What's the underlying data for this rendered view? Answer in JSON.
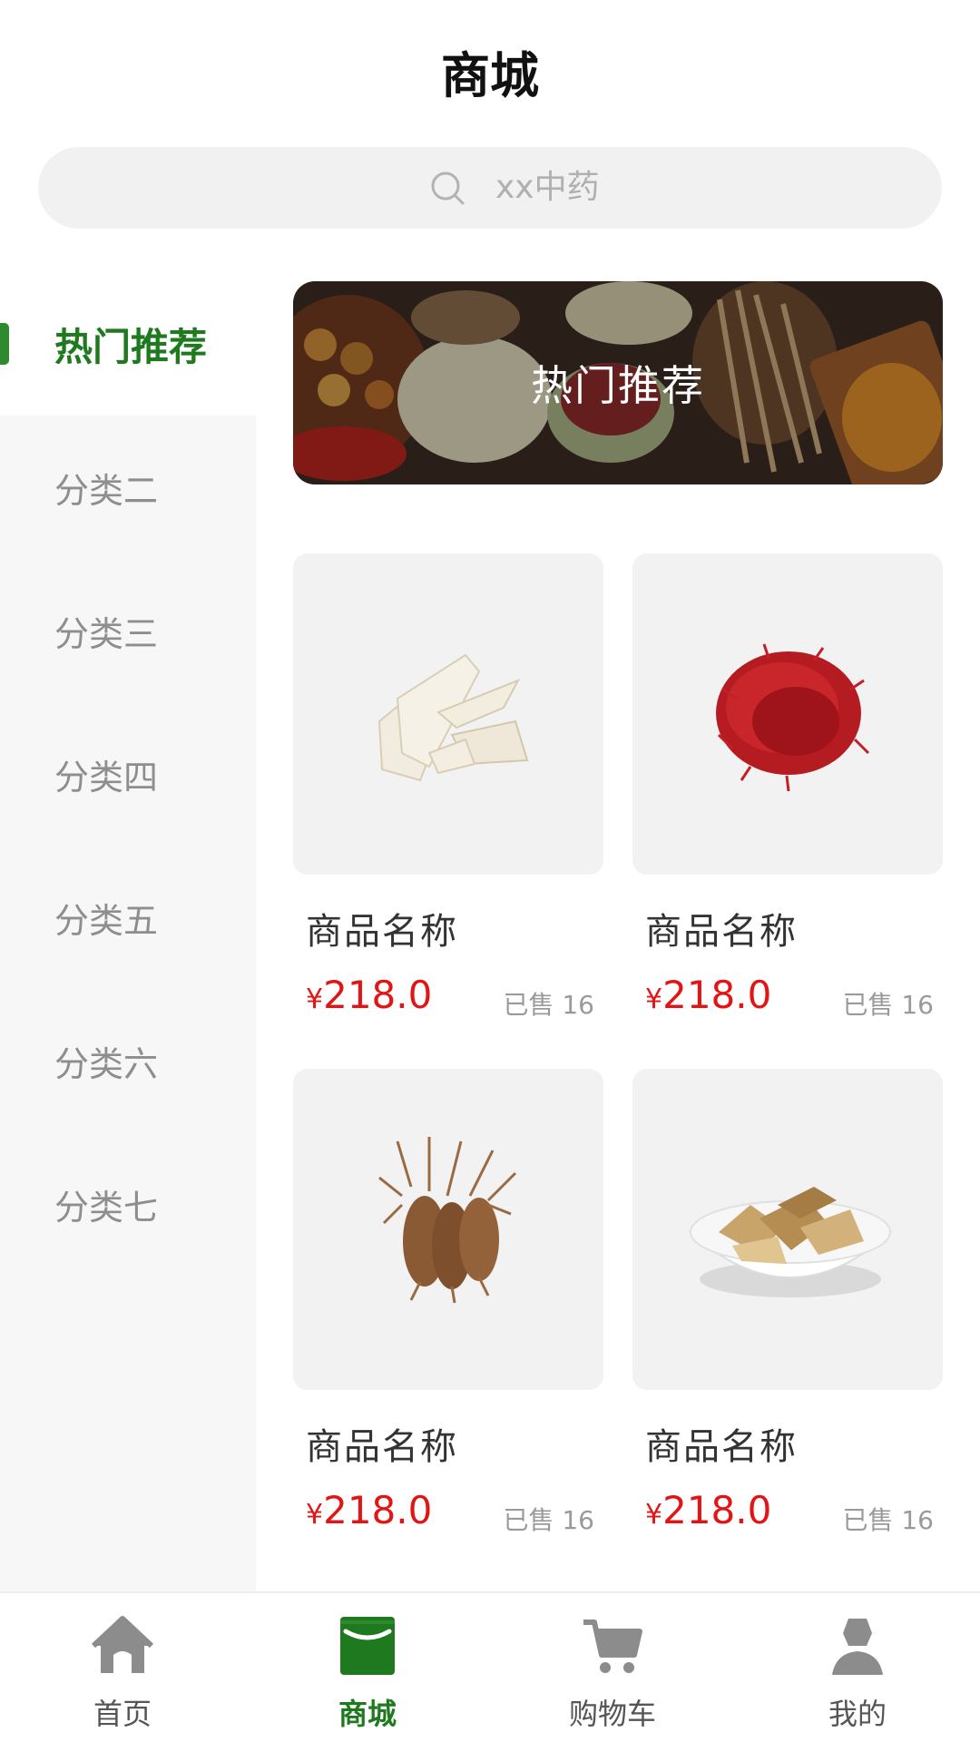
{
  "header": {
    "title": "商城"
  },
  "search": {
    "placeholder": "xx中药"
  },
  "sidebar": {
    "items": [
      {
        "label": "热门推荐",
        "active": true
      },
      {
        "label": "分类二"
      },
      {
        "label": "分类三"
      },
      {
        "label": "分类四"
      },
      {
        "label": "分类五"
      },
      {
        "label": "分类六"
      },
      {
        "label": "分类七"
      }
    ]
  },
  "banner": {
    "text": "热门推荐"
  },
  "products": [
    {
      "name": "商品名称",
      "currency": "¥",
      "price": "218.0",
      "sold": "已售 16",
      "image": "herb-slices-icon"
    },
    {
      "name": "商品名称",
      "currency": "¥",
      "price": "218.0",
      "sold": "已售 16",
      "image": "saffron-icon"
    },
    {
      "name": "商品名称",
      "currency": "¥",
      "price": "218.0",
      "sold": "已售 16",
      "image": "ginseng-root-icon"
    },
    {
      "name": "商品名称",
      "currency": "¥",
      "price": "218.0",
      "sold": "已售 16",
      "image": "herb-bowl-icon"
    }
  ],
  "tabbar": {
    "items": [
      {
        "label": "首页",
        "icon": "home-icon"
      },
      {
        "label": "商城",
        "icon": "store-icon",
        "active": true
      },
      {
        "label": "购物车",
        "icon": "cart-icon"
      },
      {
        "label": "我的",
        "icon": "user-icon"
      }
    ]
  },
  "colors": {
    "accent": "#1f7a1f",
    "price": "#e31414"
  }
}
